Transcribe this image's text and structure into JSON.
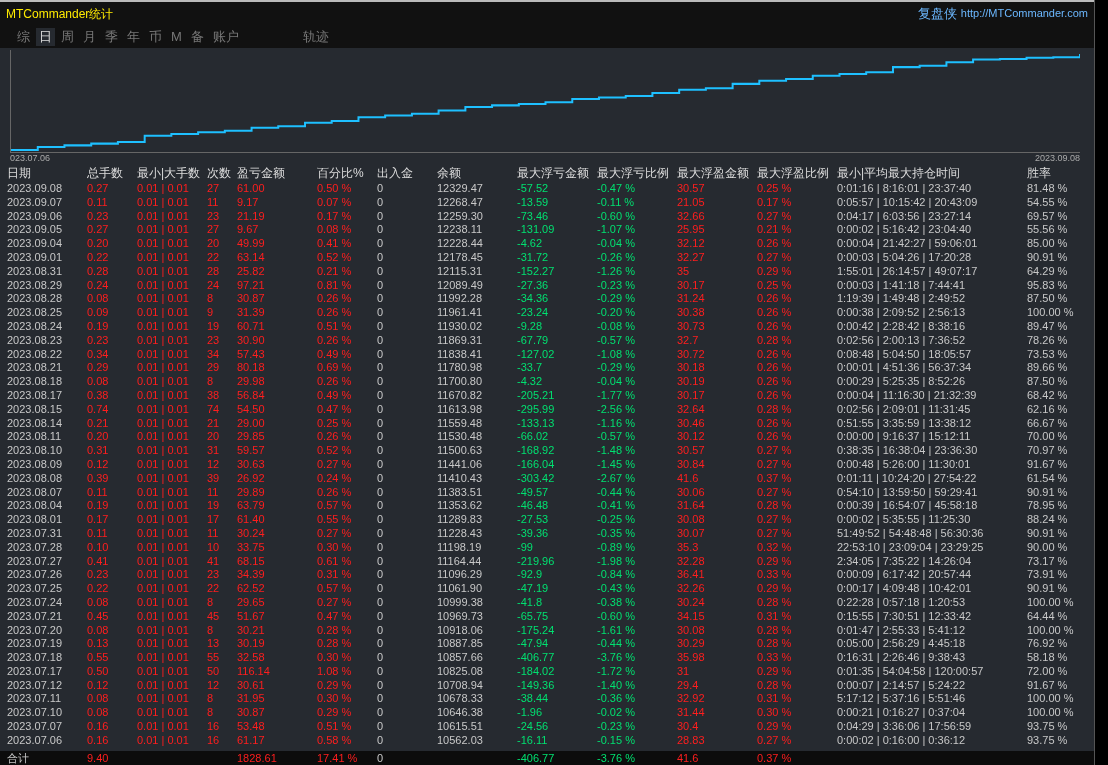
{
  "window": {
    "title": "MTCommander统计",
    "brand": "复盘侠",
    "link": "http://MTCommander.com"
  },
  "tabs": [
    {
      "label": "综",
      "selected": false
    },
    {
      "label": "日",
      "selected": true
    },
    {
      "label": "周",
      "selected": false
    },
    {
      "label": "月",
      "selected": false
    },
    {
      "label": "季",
      "selected": false
    },
    {
      "label": "年",
      "selected": false
    },
    {
      "label": "币",
      "selected": false
    },
    {
      "label": "M",
      "selected": false
    },
    {
      "label": "备",
      "selected": false
    },
    {
      "label": "账户",
      "selected": false
    },
    {
      "label": "轨迹",
      "selected": false
    }
  ],
  "chart": {
    "start_label": "023.07.06",
    "end_label": "2023.09.08"
  },
  "table": {
    "columns": [
      "日期",
      "总手数",
      "最小|大手数",
      "次数",
      "盈亏金额",
      "百分比%",
      "出入金",
      "余额",
      "最大浮亏金额",
      "最大浮亏比例",
      "最大浮盈金额",
      "最大浮盈比例",
      "最小|平均最大持仓时间",
      "胜率"
    ],
    "rows": [
      [
        "2023.09.08",
        "0.27",
        "0.01 | 0.01",
        "27",
        "61.00",
        "0.50 %",
        "0",
        "12329.47",
        "-57.52",
        "-0.47 %",
        "30.57",
        "0.25 %",
        "0:01:16 | 8:16:01 | 23:37:40",
        "81.48 %"
      ],
      [
        "2023.09.07",
        "0.11",
        "0.01 | 0.01",
        "11",
        "9.17",
        "0.07 %",
        "0",
        "12268.47",
        "-13.59",
        "-0.11 %",
        "21.05",
        "0.17 %",
        "0:05:57 | 10:15:42 | 20:43:09",
        "54.55 %"
      ],
      [
        "2023.09.06",
        "0.23",
        "0.01 | 0.01",
        "23",
        "21.19",
        "0.17 %",
        "0",
        "12259.30",
        "-73.46",
        "-0.60 %",
        "32.66",
        "0.27 %",
        "0:04:17 | 6:03:56 | 23:27:14",
        "69.57 %"
      ],
      [
        "2023.09.05",
        "0.27",
        "0.01 | 0.01",
        "27",
        "9.67",
        "0.08 %",
        "0",
        "12238.11",
        "-131.09",
        "-1.07 %",
        "25.95",
        "0.21 %",
        "0:00:02 | 5:16:42 | 23:04:40",
        "55.56 %"
      ],
      [
        "2023.09.04",
        "0.20",
        "0.01 | 0.01",
        "20",
        "49.99",
        "0.41 %",
        "0",
        "12228.44",
        "-4.62",
        "-0.04 %",
        "32.12",
        "0.26 %",
        "0:00:04 | 21:42:27 | 59:06:01",
        "85.00 %"
      ],
      [
        "2023.09.01",
        "0.22",
        "0.01 | 0.01",
        "22",
        "63.14",
        "0.52 %",
        "0",
        "12178.45",
        "-31.72",
        "-0.26 %",
        "32.27",
        "0.27 %",
        "0:00:03 | 5:04:26 | 17:20:28",
        "90.91 %"
      ],
      [
        "2023.08.31",
        "0.28",
        "0.01 | 0.01",
        "28",
        "25.82",
        "0.21 %",
        "0",
        "12115.31",
        "-152.27",
        "-1.26 %",
        "35",
        "0.29 %",
        "1:55:01 | 26:14:57 | 49:07:17",
        "64.29 %"
      ],
      [
        "2023.08.29",
        "0.24",
        "0.01 | 0.01",
        "24",
        "97.21",
        "0.81 %",
        "0",
        "12089.49",
        "-27.36",
        "-0.23 %",
        "30.17",
        "0.25 %",
        "0:00:03 | 1:41:18 | 7:44:41",
        "95.83 %"
      ],
      [
        "2023.08.28",
        "0.08",
        "0.01 | 0.01",
        "8",
        "30.87",
        "0.26 %",
        "0",
        "11992.28",
        "-34.36",
        "-0.29 %",
        "31.24",
        "0.26 %",
        "1:19:39 | 1:49:48 | 2:49:52",
        "87.50 %"
      ],
      [
        "2023.08.25",
        "0.09",
        "0.01 | 0.01",
        "9",
        "31.39",
        "0.26 %",
        "0",
        "11961.41",
        "-23.24",
        "-0.20 %",
        "30.38",
        "0.26 %",
        "0:00:38 | 2:09:52 | 2:56:13",
        "100.00 %"
      ],
      [
        "2023.08.24",
        "0.19",
        "0.01 | 0.01",
        "19",
        "60.71",
        "0.51 %",
        "0",
        "11930.02",
        "-9.28",
        "-0.08 %",
        "30.73",
        "0.26 %",
        "0:00:42 | 2:28:42 | 8:38:16",
        "89.47 %"
      ],
      [
        "2023.08.23",
        "0.23",
        "0.01 | 0.01",
        "23",
        "30.90",
        "0.26 %",
        "0",
        "11869.31",
        "-67.79",
        "-0.57 %",
        "32.7",
        "0.28 %",
        "0:02:56 | 2:00:13 | 7:36:52",
        "78.26 %"
      ],
      [
        "2023.08.22",
        "0.34",
        "0.01 | 0.01",
        "34",
        "57.43",
        "0.49 %",
        "0",
        "11838.41",
        "-127.02",
        "-1.08 %",
        "30.72",
        "0.26 %",
        "0:08:48 | 5:04:50 | 18:05:57",
        "73.53 %"
      ],
      [
        "2023.08.21",
        "0.29",
        "0.01 | 0.01",
        "29",
        "80.18",
        "0.69 %",
        "0",
        "11780.98",
        "-33.7",
        "-0.29 %",
        "30.18",
        "0.26 %",
        "0:00:01 | 4:51:36 | 56:37:34",
        "89.66 %"
      ],
      [
        "2023.08.18",
        "0.08",
        "0.01 | 0.01",
        "8",
        "29.98",
        "0.26 %",
        "0",
        "11700.80",
        "-4.32",
        "-0.04 %",
        "30.19",
        "0.26 %",
        "0:00:29 | 5:25:35 | 8:52:26",
        "87.50 %"
      ],
      [
        "2023.08.17",
        "0.38",
        "0.01 | 0.01",
        "38",
        "56.84",
        "0.49 %",
        "0",
        "11670.82",
        "-205.21",
        "-1.77 %",
        "30.17",
        "0.26 %",
        "0:00:04 | 11:16:30 | 21:32:39",
        "68.42 %"
      ],
      [
        "2023.08.15",
        "0.74",
        "0.01 | 0.01",
        "74",
        "54.50",
        "0.47 %",
        "0",
        "11613.98",
        "-295.99",
        "-2.56 %",
        "32.64",
        "0.28 %",
        "0:02:56 | 2:09:01 | 11:31:45",
        "62.16 %"
      ],
      [
        "2023.08.14",
        "0.21",
        "0.01 | 0.01",
        "21",
        "29.00",
        "0.25 %",
        "0",
        "11559.48",
        "-133.13",
        "-1.16 %",
        "30.46",
        "0.26 %",
        "0:51:55 | 3:35:59 | 13:38:12",
        "66.67 %"
      ],
      [
        "2023.08.11",
        "0.20",
        "0.01 | 0.01",
        "20",
        "29.85",
        "0.26 %",
        "0",
        "11530.48",
        "-66.02",
        "-0.57 %",
        "30.12",
        "0.26 %",
        "0:00:00 | 9:16:37 | 15:12:11",
        "70.00 %"
      ],
      [
        "2023.08.10",
        "0.31",
        "0.01 | 0.01",
        "31",
        "59.57",
        "0.52 %",
        "0",
        "11500.63",
        "-168.92",
        "-1.48 %",
        "30.57",
        "0.27 %",
        "0:38:35 | 16:38:04 | 23:36:30",
        "70.97 %"
      ],
      [
        "2023.08.09",
        "0.12",
        "0.01 | 0.01",
        "12",
        "30.63",
        "0.27 %",
        "0",
        "11441.06",
        "-166.04",
        "-1.45 %",
        "30.84",
        "0.27 %",
        "0:00:48 | 5:26:00 | 11:30:01",
        "91.67 %"
      ],
      [
        "2023.08.08",
        "0.39",
        "0.01 | 0.01",
        "39",
        "26.92",
        "0.24 %",
        "0",
        "11410.43",
        "-303.42",
        "-2.67 %",
        "41.6",
        "0.37 %",
        "0:01:11 | 10:24:20 | 27:54:22",
        "61.54 %"
      ],
      [
        "2023.08.07",
        "0.11",
        "0.01 | 0.01",
        "11",
        "29.89",
        "0.26 %",
        "0",
        "11383.51",
        "-49.57",
        "-0.44 %",
        "30.06",
        "0.27 %",
        "0:54:10 | 13:59:50 | 59:29:41",
        "90.91 %"
      ],
      [
        "2023.08.04",
        "0.19",
        "0.01 | 0.01",
        "19",
        "63.79",
        "0.57 %",
        "0",
        "11353.62",
        "-46.48",
        "-0.41 %",
        "31.64",
        "0.28 %",
        "0:00:39 | 16:54:07 | 45:58:18",
        "78.95 %"
      ],
      [
        "2023.08.01",
        "0.17",
        "0.01 | 0.01",
        "17",
        "61.40",
        "0.55 %",
        "0",
        "11289.83",
        "-27.53",
        "-0.25 %",
        "30.08",
        "0.27 %",
        "0:00:02 | 5:35:55 | 11:25:30",
        "88.24 %"
      ],
      [
        "2023.07.31",
        "0.11",
        "0.01 | 0.01",
        "11",
        "30.24",
        "0.27 %",
        "0",
        "11228.43",
        "-39.36",
        "-0.35 %",
        "30.07",
        "0.27 %",
        "51:49:52 | 54:48:48 | 56:30:36",
        "90.91 %"
      ],
      [
        "2023.07.28",
        "0.10",
        "0.01 | 0.01",
        "10",
        "33.75",
        "0.30 %",
        "0",
        "11198.19",
        "-99",
        "-0.89 %",
        "35.3",
        "0.32 %",
        "22:53:10 | 23:09:04 | 23:29:25",
        "90.00 %"
      ],
      [
        "2023.07.27",
        "0.41",
        "0.01 | 0.01",
        "41",
        "68.15",
        "0.61 %",
        "0",
        "11164.44",
        "-219.96",
        "-1.98 %",
        "32.28",
        "0.29 %",
        "2:34:05 | 7:35:22 | 14:26:04",
        "73.17 %"
      ],
      [
        "2023.07.26",
        "0.23",
        "0.01 | 0.01",
        "23",
        "34.39",
        "0.31 %",
        "0",
        "11096.29",
        "-92.9",
        "-0.84 %",
        "36.41",
        "0.33 %",
        "0:00:09 | 6:17:42 | 20:57:44",
        "73.91 %"
      ],
      [
        "2023.07.25",
        "0.22",
        "0.01 | 0.01",
        "22",
        "62.52",
        "0.57 %",
        "0",
        "11061.90",
        "-47.19",
        "-0.43 %",
        "32.26",
        "0.29 %",
        "0:00:17 | 4:09:48 | 10:42:01",
        "90.91 %"
      ],
      [
        "2023.07.24",
        "0.08",
        "0.01 | 0.01",
        "8",
        "29.65",
        "0.27 %",
        "0",
        "10999.38",
        "-41.8",
        "-0.38 %",
        "30.24",
        "0.28 %",
        "0:22:28 | 0:57:18 | 1:20:53",
        "100.00 %"
      ],
      [
        "2023.07.21",
        "0.45",
        "0.01 | 0.01",
        "45",
        "51.67",
        "0.47 %",
        "0",
        "10969.73",
        "-65.75",
        "-0.60 %",
        "34.15",
        "0.31 %",
        "0:15:55 | 7:30:51 | 12:33:42",
        "64.44 %"
      ],
      [
        "2023.07.20",
        "0.08",
        "0.01 | 0.01",
        "8",
        "30.21",
        "0.28 %",
        "0",
        "10918.06",
        "-175.24",
        "-1.61 %",
        "30.08",
        "0.28 %",
        "0:01:47 | 2:55:33 | 5:41:12",
        "100.00 %"
      ],
      [
        "2023.07.19",
        "0.13",
        "0.01 | 0.01",
        "13",
        "30.19",
        "0.28 %",
        "0",
        "10887.85",
        "-47.94",
        "-0.44 %",
        "30.29",
        "0.28 %",
        "0:05:00 | 2:56:29 | 4:45:18",
        "76.92 %"
      ],
      [
        "2023.07.18",
        "0.55",
        "0.01 | 0.01",
        "55",
        "32.58",
        "0.30 %",
        "0",
        "10857.66",
        "-406.77",
        "-3.76 %",
        "35.98",
        "0.33 %",
        "0:16:31 | 2:26:46 | 9:38:43",
        "58.18 %"
      ],
      [
        "2023.07.17",
        "0.50",
        "0.01 | 0.01",
        "50",
        "116.14",
        "1.08 %",
        "0",
        "10825.08",
        "-184.02",
        "-1.72 %",
        "31",
        "0.29 %",
        "0:01:35 | 54:04:58 | 120:00:57",
        "72.00 %"
      ],
      [
        "2023.07.12",
        "0.12",
        "0.01 | 0.01",
        "12",
        "30.61",
        "0.29 %",
        "0",
        "10708.94",
        "-149.36",
        "-1.40 %",
        "29.4",
        "0.28 %",
        "0:00:07 | 2:14:57 | 5:24:22",
        "91.67 %"
      ],
      [
        "2023.07.11",
        "0.08",
        "0.01 | 0.01",
        "8",
        "31.95",
        "0.30 %",
        "0",
        "10678.33",
        "-38.44",
        "-0.36 %",
        "32.92",
        "0.31 %",
        "5:17:12 | 5:37:16 | 5:51:46",
        "100.00 %"
      ],
      [
        "2023.07.10",
        "0.08",
        "0.01 | 0.01",
        "8",
        "30.87",
        "0.29 %",
        "0",
        "10646.38",
        "-1.96",
        "-0.02 %",
        "31.44",
        "0.30 %",
        "0:00:21 | 0:16:27 | 0:37:04",
        "100.00 %"
      ],
      [
        "2023.07.07",
        "0.16",
        "0.01 | 0.01",
        "16",
        "53.48",
        "0.51 %",
        "0",
        "10615.51",
        "-24.56",
        "-0.23 %",
        "30.4",
        "0.29 %",
        "0:04:29 | 3:36:06 | 17:56:59",
        "93.75 %"
      ],
      [
        "2023.07.06",
        "0.16",
        "0.01 | 0.01",
        "16",
        "61.17",
        "0.58 %",
        "0",
        "10562.03",
        "-16.11",
        "-0.15 %",
        "28.83",
        "0.27 %",
        "0:00:02 | 0:16:00 | 0:36:12",
        "93.75 %"
      ]
    ],
    "total": {
      "label": "合计",
      "lots": "9.40",
      "profit": "1828.61",
      "percent": "17.41 %",
      "deposit": "0",
      "max_loss": "-406.77",
      "max_loss_pct": "-3.76 %",
      "max_profit": "41.6",
      "max_profit_pct": "0.37 %"
    }
  }
}
